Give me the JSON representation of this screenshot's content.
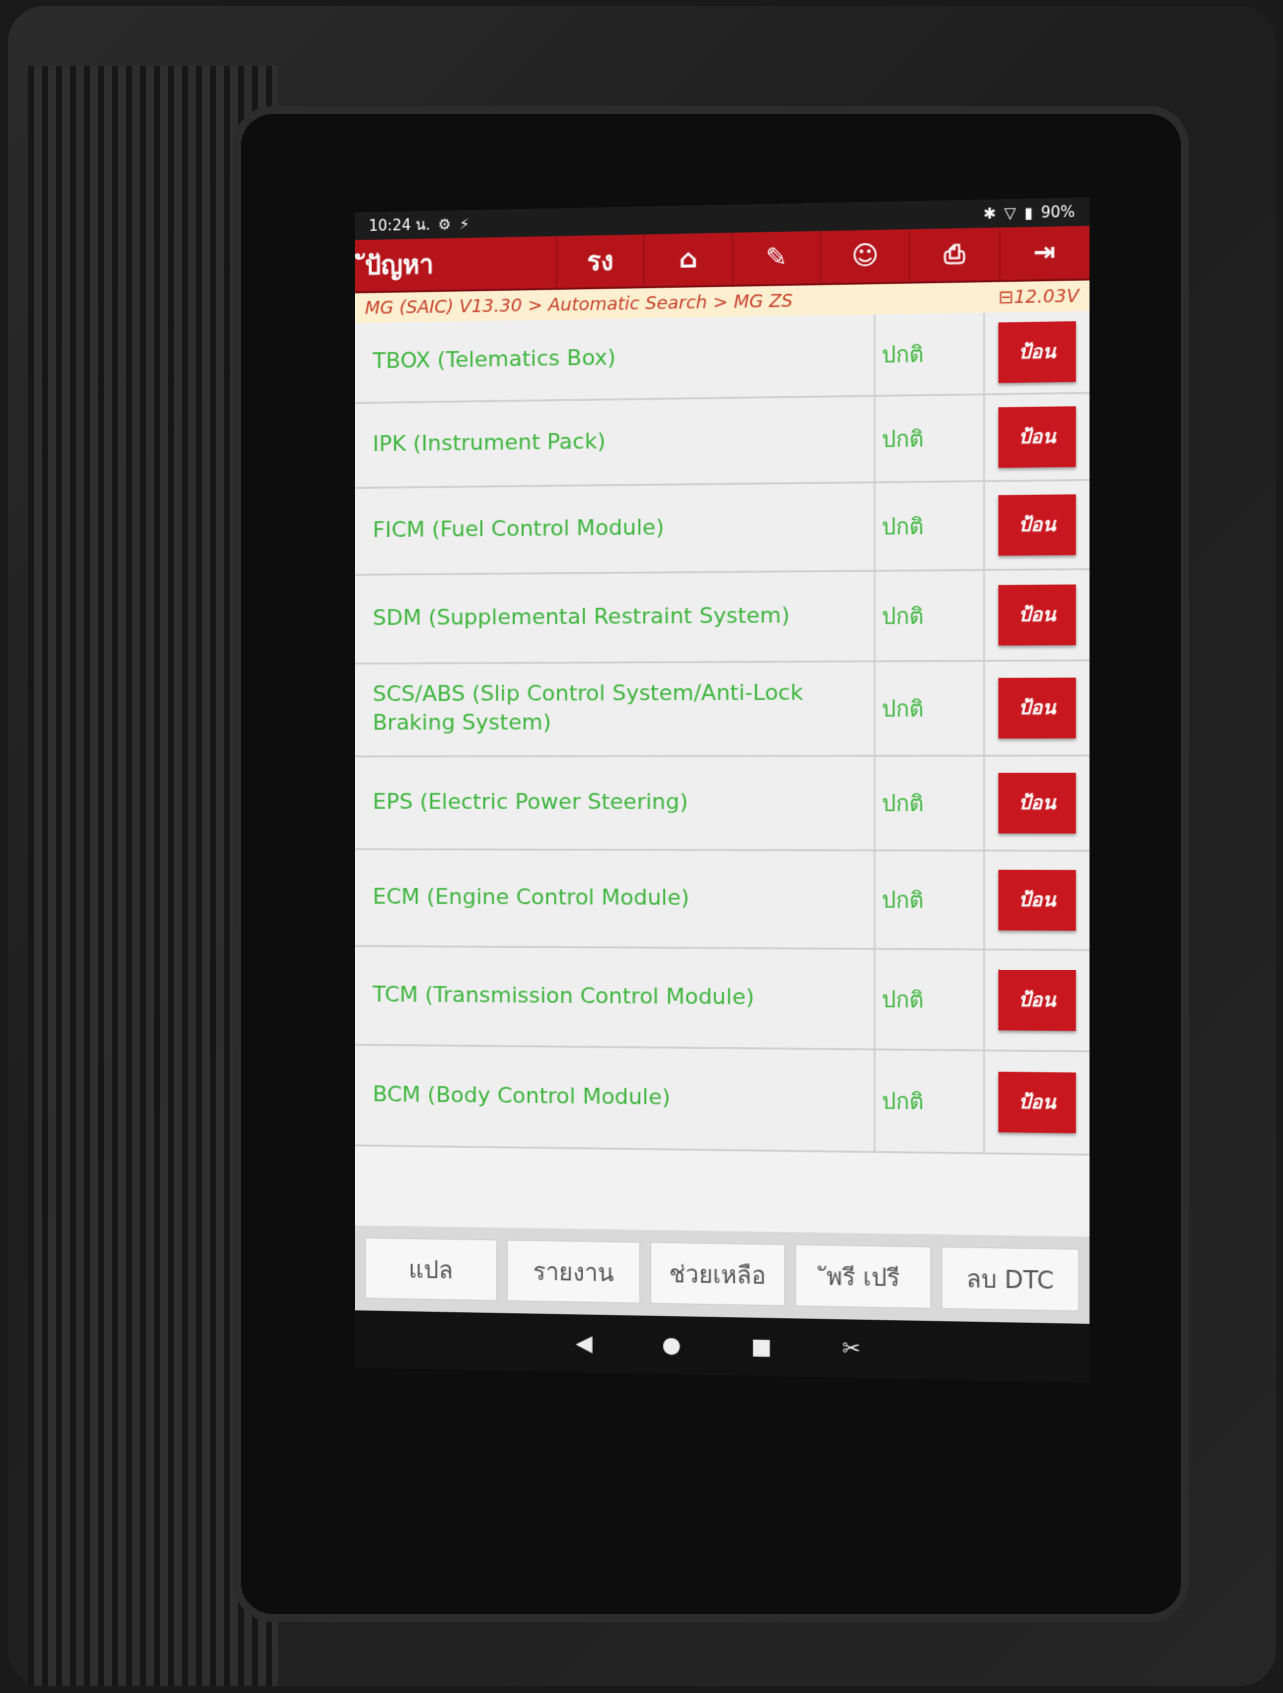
{
  "status_bar": {
    "time": "10:24 น.",
    "left_icons": [
      "settings-icon",
      "usb-icon"
    ],
    "right_icons": [
      "bluetooth-icon",
      "wifi-icon",
      "battery-icon"
    ],
    "battery": "90%"
  },
  "toolbar": {
    "title": "ัปัญหา",
    "buttons": [
      {
        "label": "รง",
        "icon": "report-short-icon"
      },
      {
        "label": "⌂",
        "icon": "home-icon"
      },
      {
        "label": "✎",
        "icon": "edit-icon"
      },
      {
        "label": "☺",
        "icon": "user-icon"
      },
      {
        "label": "⎙",
        "icon": "print-icon"
      },
      {
        "label": "⇥",
        "icon": "exit-icon"
      }
    ],
    "accent": "#b5141b"
  },
  "breadcrumb": {
    "path": "MG (SAIC) V13.30 > Automatic Search > MG ZS",
    "voltage": "12.03V"
  },
  "systems": [
    {
      "name": "TBOX (Telematics Box)",
      "status": "ปกติ",
      "action": "ป้อน"
    },
    {
      "name": "IPK (Instrument Pack)",
      "status": "ปกติ",
      "action": "ป้อน"
    },
    {
      "name": "FICM (Fuel Control Module)",
      "status": "ปกติ",
      "action": "ป้อน"
    },
    {
      "name": "SDM (Supplemental Restraint System)",
      "status": "ปกติ",
      "action": "ป้อน"
    },
    {
      "name": "SCS/ABS (Slip Control System/Anti-Lock Braking System)",
      "status": "ปกติ",
      "action": "ป้อน"
    },
    {
      "name": "EPS (Electric Power Steering)",
      "status": "ปกติ",
      "action": "ป้อน"
    },
    {
      "name": "ECM (Engine Control Module)",
      "status": "ปกติ",
      "action": "ป้อน"
    },
    {
      "name": "TCM (Transmission Control Module)",
      "status": "ปกติ",
      "action": "ป้อน"
    },
    {
      "name": "BCM (Body Control Module)",
      "status": "ปกติ",
      "action": "ป้อน"
    }
  ],
  "bottom_buttons": [
    "แปล",
    "รายงาน",
    "ช่วยเหลือ",
    "ัพรี เปรี",
    "ลบ DTC"
  ],
  "nav_bar": [
    {
      "label": "◀",
      "icon": "back-icon"
    },
    {
      "label": "●",
      "icon": "home-circle-icon"
    },
    {
      "label": "■",
      "icon": "recent-apps-icon"
    },
    {
      "label": "✂",
      "icon": "screenshot-icon"
    }
  ],
  "colors": {
    "ok_text": "#3eb53e",
    "button_red": "#c8171e",
    "breadcrumb_text": "#c8402a"
  }
}
